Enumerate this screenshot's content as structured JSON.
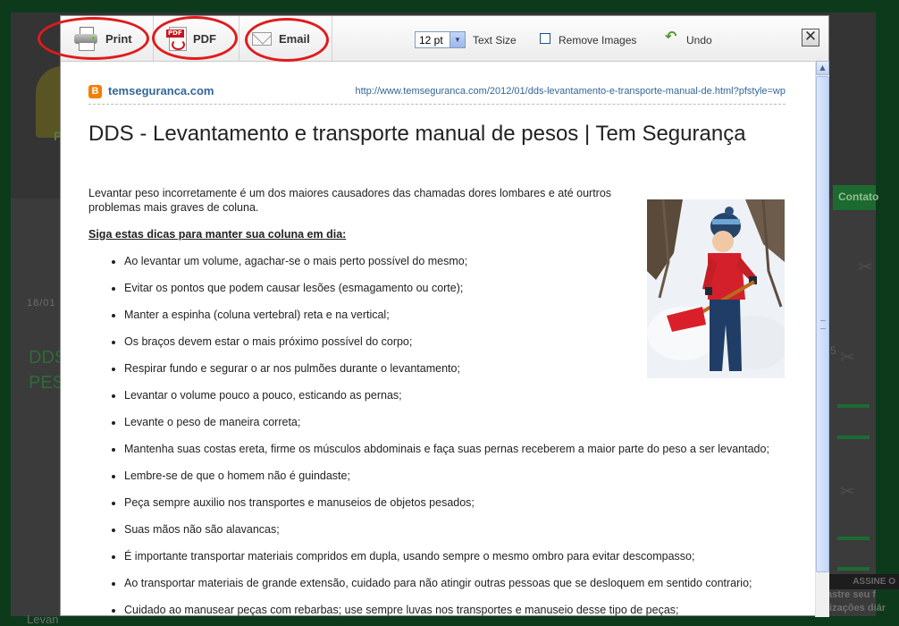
{
  "background": {
    "logo_letter": "P",
    "nav_item": "Contato",
    "date": "18/01",
    "title_line1": "DDS",
    "title_line2": "PES",
    "bottom_text": "Levan",
    "right_number": "5",
    "subscribe": "ASSINE O",
    "subscribe_line1": "astre seu f",
    "subscribe_line2": "lizações diár"
  },
  "toolbar": {
    "print_label": "Print",
    "pdf_label": "PDF",
    "email_label": "Email",
    "font_size_value": "12 pt",
    "text_size_label": "Text Size",
    "remove_images_label": "Remove Images",
    "undo_label": "Undo",
    "close_symbol": "✕",
    "annotation_color": "#e01b1b"
  },
  "article": {
    "source_name": "temseguranca.com",
    "source_url": "http://www.temseguranca.com/2012/01/dds-levantamento-e-transporte-manual-de.html?pfstyle=wp",
    "title": "DDS - Levantamento e transporte manual de pesos | Tem Segurança",
    "intro": "Levantar peso incorretamente é um dos maiores causadores das chamadas dores lombares e até ourtros problemas mais graves de coluna.",
    "subheading": "Siga estas dicas para manter sua coluna em dia:",
    "tips": [
      "Ao levantar um volume, agachar-se o mais perto possível do mesmo;",
      "Evitar os pontos que podem causar lesões (esmagamento ou corte);",
      "Manter a espinha (coluna vertebral) reta e na vertical;",
      "Os braços devem estar o mais próximo possível do corpo;",
      "Respirar fundo e segurar o ar nos pulmões durante o levantamento;",
      "Levantar o volume pouco a pouco, esticando as pernas;",
      "Levante o peso de maneira correta;",
      "Mantenha suas costas ereta, firme os músculos abdominais e faça suas pernas receberem a maior parte do peso a ser levantado;",
      "Lembre-se de que o homem não é guindaste;",
      "Peça sempre auxilio nos transportes e manuseios de objetos pesados;",
      "Suas mãos não são alavancas;",
      "É importante transportar materiais compridos em dupla, usando sempre o mesmo ombro para evitar descompasso;",
      "Ao transportar materiais de grande extensão, cuidado para não atingir outras pessoas que se desloquem em sentido contrario;",
      "Cuidado ao manusear peças com rebarbas; use sempre luvas nos transportes e manuseio desse tipo de peças;"
    ]
  }
}
